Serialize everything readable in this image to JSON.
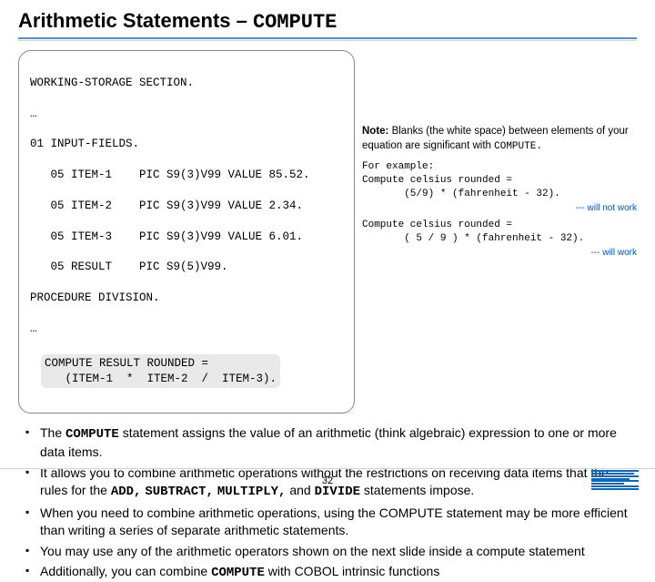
{
  "title": {
    "pre": "Arithmetic Statements – ",
    "kw": "COMPUTE"
  },
  "code": {
    "l1": "WORKING-STORAGE SECTION.",
    "l2": "…",
    "l3": "01 INPUT-FIELDS.",
    "l4": "   05 ITEM-1    PIC S9(3)V99 VALUE 85.52.",
    "l5": "   05 ITEM-2    PIC S9(3)V99 VALUE 2.34.",
    "l6": "   05 ITEM-3    PIC S9(3)V99 VALUE 6.01.",
    "l7": "   05 RESULT    PIC S9(5)V99.",
    "l8": "PROCEDURE DIVISION.",
    "l9": "…",
    "h1": "COMPUTE RESULT ROUNDED =",
    "h2": "   (ITEM-1  *  ITEM-2  /  ITEM-3)."
  },
  "note": {
    "label": "Note:",
    "body": " Blanks (the white space) between elements of your equation are significant with ",
    "kw": "COMPUTE.",
    "eg_label": "For example:",
    "bad": "Compute celsius rounded =\n       (5/9) * (fahrenheit - 32).",
    "bad_tag": "--- will not work",
    "good": "Compute celsius rounded =\n       ( 5 / 9 ) * (fahrenheit - 32).",
    "good_tag": "--- will work"
  },
  "bullets": {
    "b1a": "The ",
    "b1kw": "COMPUTE",
    "b1b": " statement assigns the value of an arithmetic (think algebraic) expression to one or more data items.",
    "b2a": "It allows you to combine arithmetic operations without the restrictions on receiving data items that the rules for the ",
    "b2k1": "ADD,",
    "b2k2": "SUBTRACT,",
    "b2k3": "MULTIPLY,",
    "b2b": " and ",
    "b2k4": "DIVIDE",
    "b2c": " statements impose.",
    "b3": "When you need to combine arithmetic operations, using the COMPUTE statement may be more efficient than writing a series of separate arithmetic statements.",
    "b4": "You may use any of the arithmetic operators shown on the next slide inside a compute statement",
    "b5a": "Additionally, you can combine ",
    "b5kw": "COMPUTE",
    "b5b": " with COBOL intrinsic functions"
  },
  "page": "32"
}
